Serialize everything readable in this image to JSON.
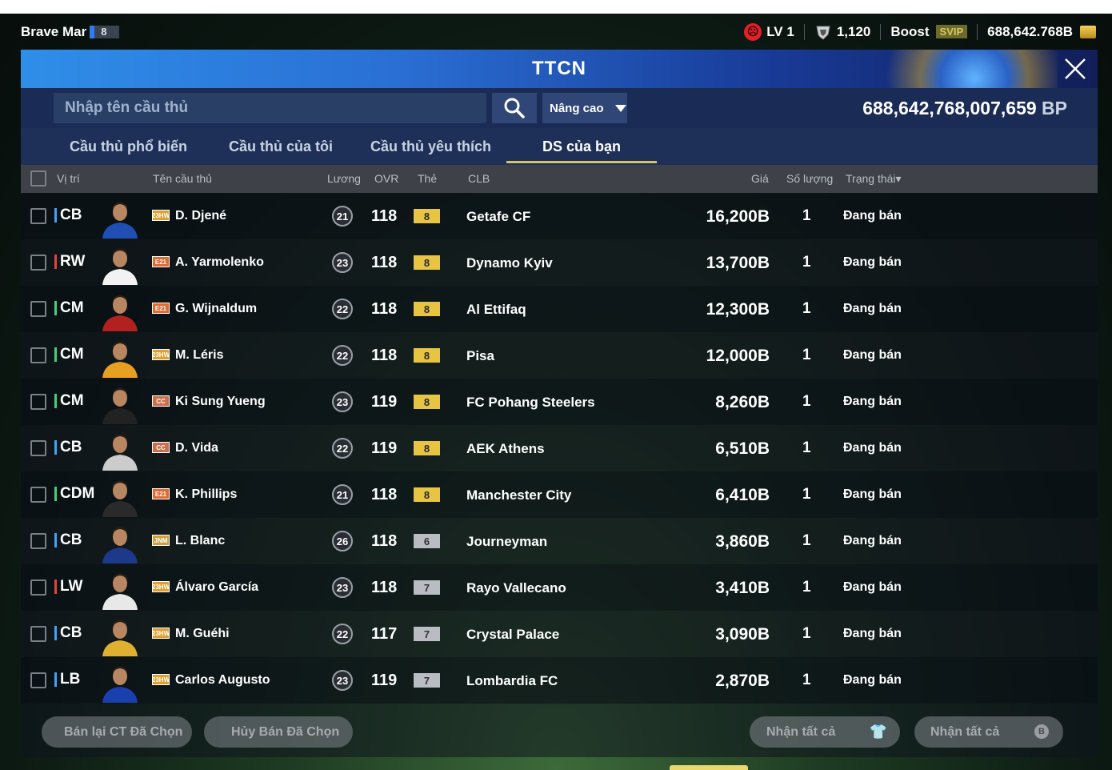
{
  "status_bar": {
    "user_name": "Brave Mar",
    "user_level_num": "8",
    "level": "LV 1",
    "fc": "1,120",
    "boost_label": "Boost",
    "svip": "SVIP",
    "currency": "688,642.768B",
    "icons": [
      "face-icon",
      "shield-icon",
      "coin-icon"
    ]
  },
  "window": {
    "title": "TTCN",
    "close_icon": "close-icon"
  },
  "toolbar": {
    "search_placeholder": "Nhập tên cầu thủ",
    "advanced_label": "Nâng cao",
    "bp_value": "688,642,768,007,659",
    "bp_unit": "BP"
  },
  "tabs": [
    {
      "label": "Cầu thủ phổ biến",
      "active": false
    },
    {
      "label": "Cầu thủ của tôi",
      "active": false
    },
    {
      "label": "Cầu thủ yêu thích",
      "active": false
    },
    {
      "label": "DS của bạn",
      "active": true
    }
  ],
  "table": {
    "headers": {
      "position": "Vị trí",
      "name": "Tên cầu thủ",
      "wage": "Lương",
      "ovr": "OVR",
      "grade": "Thẻ",
      "club": "CLB",
      "price": "Giá",
      "quantity": "Số lượng",
      "status": "Trạng thái▾"
    },
    "rows": [
      {
        "pos": "CB",
        "pos_color": "#3aa4ff",
        "season": "23HW",
        "season_color": "#e0a030",
        "name": "D. Djené",
        "wage": "21",
        "ovr": "118",
        "grade": "8",
        "grade_type": "gold",
        "club": "Getafe CF",
        "price": "16,200B",
        "qty": "1",
        "status": "Đang bán",
        "kit": "#1f4fb4"
      },
      {
        "pos": "RW",
        "pos_color": "#e8413a",
        "season": "E21",
        "season_color": "#e06a30",
        "name": "A. Yarmolenko",
        "wage": "23",
        "ovr": "118",
        "grade": "8",
        "grade_type": "gold",
        "club": "Dynamo Kyiv",
        "price": "13,700B",
        "qty": "1",
        "status": "Đang bán",
        "kit": "#f2f2f2"
      },
      {
        "pos": "CM",
        "pos_color": "#3ed07a",
        "season": "E21",
        "season_color": "#e06a30",
        "name": "G. Wijnaldum",
        "wage": "22",
        "ovr": "118",
        "grade": "8",
        "grade_type": "gold",
        "club": "Al Ettifaq",
        "price": "12,300B",
        "qty": "1",
        "status": "Đang bán",
        "kit": "#b22020"
      },
      {
        "pos": "CM",
        "pos_color": "#3ed07a",
        "season": "23HW",
        "season_color": "#e0a030",
        "name": "M. Léris",
        "wage": "22",
        "ovr": "118",
        "grade": "8",
        "grade_type": "gold",
        "club": "Pisa",
        "price": "12,000B",
        "qty": "1",
        "status": "Đang bán",
        "kit": "#e8a020"
      },
      {
        "pos": "CM",
        "pos_color": "#3ed07a",
        "season": "CC",
        "season_color": "#c9704a",
        "name": "Ki Sung Yueng",
        "wage": "23",
        "ovr": "119",
        "grade": "8",
        "grade_type": "gold",
        "club": "FC Pohang Steelers",
        "price": "8,260B",
        "qty": "1",
        "status": "Đang bán",
        "kit": "#222"
      },
      {
        "pos": "CB",
        "pos_color": "#3aa4ff",
        "season": "CC",
        "season_color": "#c9704a",
        "name": "D. Vida",
        "wage": "22",
        "ovr": "119",
        "grade": "8",
        "grade_type": "gold",
        "club": "AEK Athens",
        "price": "6,510B",
        "qty": "1",
        "status": "Đang bán",
        "kit": "#ccc"
      },
      {
        "pos": "CDM",
        "pos_color": "#3ed07a",
        "season": "E21",
        "season_color": "#e06a30",
        "name": "K. Phillips",
        "wage": "21",
        "ovr": "118",
        "grade": "8",
        "grade_type": "gold",
        "club": "Manchester City",
        "price": "6,410B",
        "qty": "1",
        "status": "Đang bán",
        "kit": "#2a2a2a"
      },
      {
        "pos": "CB",
        "pos_color": "#3aa4ff",
        "season": "JNM",
        "season_color": "#d0a040",
        "name": "L. Blanc",
        "wage": "26",
        "ovr": "118",
        "grade": "6",
        "grade_type": "gray",
        "club": "Journeyman",
        "price": "3,860B",
        "qty": "1",
        "status": "Đang bán",
        "kit": "#1d3a8a"
      },
      {
        "pos": "LW",
        "pos_color": "#e8413a",
        "season": "23HW",
        "season_color": "#e0a030",
        "name": "Álvaro García",
        "wage": "23",
        "ovr": "118",
        "grade": "7",
        "grade_type": "gray",
        "club": "Rayo Vallecano",
        "price": "3,410B",
        "qty": "1",
        "status": "Đang bán",
        "kit": "#e8e8e8"
      },
      {
        "pos": "CB",
        "pos_color": "#3aa4ff",
        "season": "23HW",
        "season_color": "#e0a030",
        "name": "M. Guéhi",
        "wage": "22",
        "ovr": "117",
        "grade": "7",
        "grade_type": "gray",
        "club": "Crystal Palace",
        "price": "3,090B",
        "qty": "1",
        "status": "Đang bán",
        "kit": "#e0b030"
      },
      {
        "pos": "LB",
        "pos_color": "#3aa4ff",
        "season": "23HW",
        "season_color": "#e0a030",
        "name": "Carlos Augusto",
        "wage": "23",
        "ovr": "119",
        "grade": "7",
        "grade_type": "gray",
        "club": "Lombardia FC",
        "price": "2,870B",
        "qty": "1",
        "status": "Đang bán",
        "kit": "#1a3fae"
      }
    ]
  },
  "footer": {
    "resell_selected": "Bán lại CT Đã Chọn",
    "cancel_selected": "Hủy Bán Đã Chọn",
    "receive_all_1": "Nhận tất cả",
    "receive_all_2": "Nhận tất cả"
  }
}
